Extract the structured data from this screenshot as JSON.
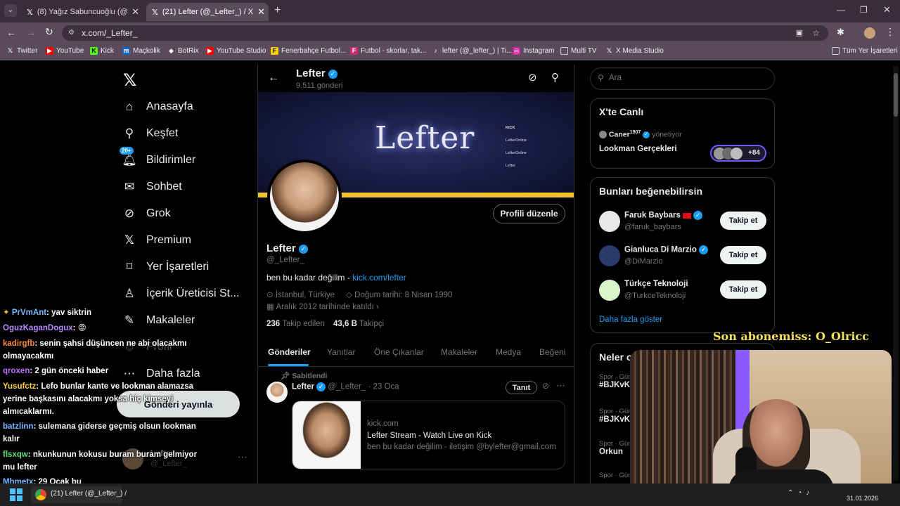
{
  "browser": {
    "tabs": [
      {
        "title": "(8) Yağız Sabuncuoğlu (@yagos",
        "active": false
      },
      {
        "title": "(21) Lefter (@_Lefter_) / X",
        "active": true
      }
    ],
    "url": "x.com/_Lefter_",
    "bookmarks": [
      "Twitter",
      "YouTube",
      "Kick",
      "Maçkolik",
      "BotRix",
      "YouTube Studio",
      "Fenerbahçe Futbol...",
      "Futbol - skorlar, tak...",
      "lefter (@_lefter_) | Ti...",
      "Instagram",
      "Multi TV",
      "X Media Studio",
      "Tüm Yer İşaretleri"
    ]
  },
  "nav": {
    "items": [
      "Anasayfa",
      "Keşfet",
      "Bildirimler",
      "Sohbet",
      "Grok",
      "Premium",
      "Yer İşaretleri",
      "İçerik Üreticisi St...",
      "Makaleler",
      "Profil",
      "Daha fazla"
    ],
    "notif_badge": "20+",
    "post_button": "Gönderi yayınla",
    "account_name": "Lefter",
    "account_handle": "@_Lefter_"
  },
  "profile": {
    "name": "Lefter",
    "posts_count": "9.511 gönderi",
    "banner_text": "Lefter",
    "banner_links": [
      "KICK",
      "LefterOnline",
      "LefterOnline",
      "Lefter"
    ],
    "edit_button": "Profili düzenle",
    "handle": "@_Lefter_",
    "bio_text": "ben bu kadar değilim - ",
    "bio_link": "kick.com/lefter",
    "location": "İstanbul, Türkiye",
    "birth": "Doğum tarihi: 8 Nisan 1990",
    "joined": "Aralık 2012 tarihinde katıldı",
    "following_num": "236",
    "following_label": "Takip edilen",
    "followers_num": "43,6 B",
    "followers_label": "Takipçi",
    "tabs": [
      "Gönderiler",
      "Yanıtlar",
      "Öne Çıkanlar",
      "Makaleler",
      "Medya",
      "Beğeni"
    ]
  },
  "pinned": {
    "label": "Sabitlendi",
    "name": "Lefter",
    "handle": "@_Lefter_",
    "date": "23 Oca",
    "promote": "Tanıt",
    "card_domain": "kick.com",
    "card_title": "Lefter Stream - Watch Live on Kick",
    "card_desc": "ben bu kadar değilim - iletişim @bylefter@gmail.com"
  },
  "sidebar": {
    "search_placeholder": "Ara",
    "live_title": "X'te Canlı",
    "live_host": "Caner",
    "live_host_sup": "1907",
    "live_host_role": "yönetiyor",
    "live_topic": "Lookman Gerçekleri",
    "live_count": "+84",
    "suggest_title": "Bunları beğenebilirsin",
    "suggestions": [
      {
        "name": "Faruk Baybars",
        "handle": "@faruk_baybars",
        "button": "Takip et"
      },
      {
        "name": "Gianluca Di Marzio",
        "handle": "@DiMarzio",
        "button": "Takip et"
      },
      {
        "name": "Türkçe Teknoloji",
        "handle": "@TurkceTeknoloji",
        "button": "Takip et"
      }
    ],
    "show_more": "Daha fazla göster",
    "trends_title": "Neler o",
    "trends": [
      {
        "meta": "Spor · Gün",
        "tag": "#BJKvKI"
      },
      {
        "meta": "Spor · Gün",
        "tag": "#BJKvKC"
      },
      {
        "meta": "Spor · Gün",
        "tag": "Orkun"
      },
      {
        "meta": "Spor · Gün",
        "tag": ""
      }
    ]
  },
  "overlay": {
    "subscriber_banner": "Son abonemiss: O_Olricc",
    "chat": [
      {
        "user": "PrVmAnt",
        "msg": ": yav siktrin"
      },
      {
        "user": "OguzKaganDogux",
        "msg": ": 😡"
      },
      {
        "user": "kadirgfb",
        "msg": ": senin şahsi düşüncen ne abi olacakmı olmayacakmı"
      },
      {
        "user": "qroxen",
        "msg": ": 2 gün önceki haber"
      },
      {
        "user": "Yusufctz",
        "msg": ": Lefo bunlar kante ve lookman alamazsa yerine başkasını alacakmı yoksa hiç kimseyi almıcaklarmı."
      },
      {
        "user": "batzlinn",
        "msg": ": sulemana giderse geçmiş olsun lookman kalır"
      },
      {
        "user": "flsxqw",
        "msg": ": nkunkunun kokusu buram buram gelmiyor mu lefter"
      },
      {
        "user": "Mhmetx",
        "msg": ": 29 Ocak bu"
      }
    ]
  },
  "taskbar": {
    "app_label": "(21) Lefter (@_Lefter_) /",
    "date": "31.01.2026"
  },
  "colors": {
    "accent": "#1d9bf0",
    "bg": "#000000",
    "border": "#2f3336",
    "muted": "#71767b",
    "banner_gold": "#f2c230"
  }
}
